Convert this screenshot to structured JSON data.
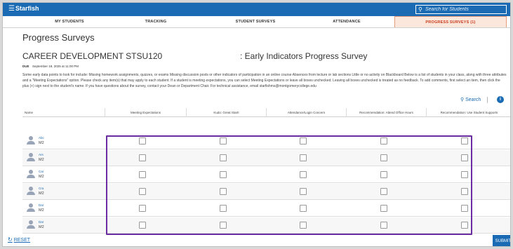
{
  "app": {
    "title": "Starfish",
    "menu_icon": "hamburger-icon"
  },
  "search": {
    "placeholder": "Search for Students",
    "icon": "search-icon"
  },
  "tabs": [
    {
      "label": "MY STUDENTS",
      "active": false
    },
    {
      "label": "TRACKING",
      "active": false
    },
    {
      "label": "STUDENT SURVEYS",
      "active": false
    },
    {
      "label": "ATTENDANCE",
      "active": false
    },
    {
      "label": "PROGRESS SURVEYS (1)",
      "active": true
    }
  ],
  "page": {
    "title": "Progress Surveys",
    "course": "CAREER DEVELOPMENT STSU120",
    "survey": ": Early Indicators Progress Survey",
    "due_label": "DUE",
    "due_value": "September 19, 2025 at 11:00 PM",
    "instructions": "Some early data points to look for include: Missing homework assignments, quizzes, or exams Missing discussion posts or other indicators of participation in an online course Absences from lecture or lab sections Little or no activity on Blackboard Below is a list of students in your class, along with three attributes and a \"Meeting Expectations\" option. Please check any item(s) that may apply to each student. If a student is meeting expectations, you can select Meeting Expectations or leave all boxes unchecked. Leaving all boxes unchecked is treated as no feedback. To add comments, first select an item, then click the plus (+) sign next to the student's name. If you have questions about the survey, contact your Dean or Department Chair. For technical assistance, email starfishms@montgomerycollege.edu"
  },
  "table_tools": {
    "search_label": "Search",
    "info_icon": "info-icon"
  },
  "table": {
    "columns": [
      "Name",
      "Meeting Expectations",
      "Kudo: Great Start!",
      "Attendance/Login Concern",
      "Recommendation: Attend Office Hours",
      "Recommendation: Use Student Supports"
    ],
    "rows": [
      {
        "name": "Abc",
        "id": "M2"
      },
      {
        "name": "Ars",
        "id": "M2"
      },
      {
        "name": "Car",
        "id": "M2"
      },
      {
        "name": "Cra",
        "id": "M2"
      },
      {
        "name": "Dar",
        "id": "M2"
      },
      {
        "name": "Dar",
        "id": "M2"
      }
    ]
  },
  "footer": {
    "reset_label": "RESET",
    "submit_label": "SUBMIT"
  },
  "colors": {
    "brand": "#1a6bb3",
    "active_tab": "#cc3a1b",
    "highlight": "#6a2ca0"
  }
}
